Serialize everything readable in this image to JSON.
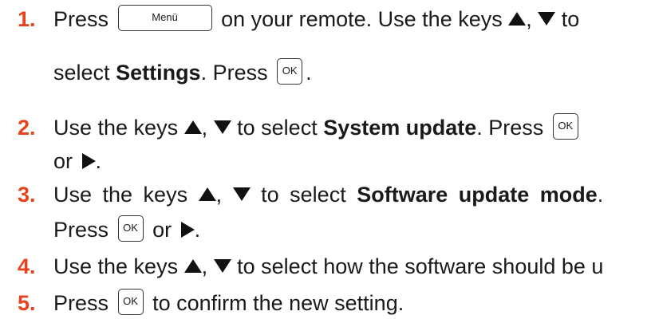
{
  "steps": [
    {
      "num": "1.",
      "l1_a": "Press",
      "key_menu": "Menü",
      "l1_b": "on your remote. Use the keys",
      "l1_c": ",",
      "l1_d": "to",
      "l2_a": "select",
      "l2_bold": "Settings",
      "l2_b": ". Press",
      "key_ok": "OK",
      "l2_c": "."
    },
    {
      "num": "2.",
      "l1_a": "Use the keys",
      "l1_b": ",",
      "l1_c": "to select",
      "l1_bold": "System update",
      "l1_d": ". Press",
      "key_ok": "OK",
      "l2_a": "or",
      "l2_b": "."
    },
    {
      "num": "3.",
      "l1_a": "Use the keys",
      "l1_b": ",",
      "l1_c": "to select",
      "l1_bold": "Software update mode",
      "l1_d": ".",
      "l2_a": "Press",
      "key_ok": "OK",
      "l2_b": "or",
      "l2_c": "."
    },
    {
      "num": "4.",
      "l1_a": "Use the keys",
      "l1_b": ",",
      "l1_c": "to select how the software should be u"
    },
    {
      "num": "5.",
      "l1_a": "Press",
      "key_ok": "OK",
      "l1_b": "to confirm the new setting."
    }
  ]
}
